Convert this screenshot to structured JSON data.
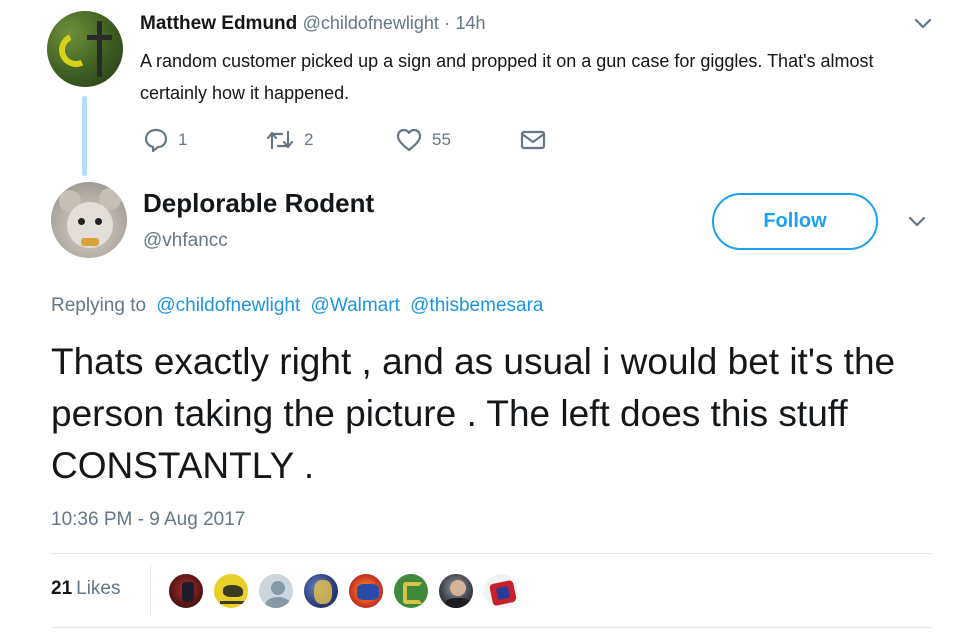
{
  "parent_tweet": {
    "name": "Matthew Edmund",
    "handle": "@childofnewlight",
    "separator": "·",
    "time": "14h",
    "text": "A random customer picked up a sign and propped it on a gun case for giggles. That's almost certainly how it happened.",
    "actions": {
      "reply_icon": "reply-icon",
      "reply_count": "1",
      "retweet_icon": "retweet-icon",
      "retweet_count": "2",
      "like_icon": "heart-icon",
      "like_count": "55",
      "dm_icon": "envelope-icon"
    }
  },
  "main_tweet": {
    "name": "Deplorable Rodent",
    "handle": "@vhfancc",
    "follow_label": "Follow",
    "replying_to_label": "Replying to",
    "mentions": [
      "@childofnewlight",
      "@Walmart",
      "@thisbemesara"
    ],
    "text": "Thats exactly right , and as usual i would bet it's the person taking the picture .  The left does this stuff CONSTANTLY .",
    "timestamp": "10:36 PM - 9 Aug 2017",
    "likes_count": "21",
    "likes_label": "Likes"
  },
  "colors": {
    "accent": "#1da1f2",
    "mention": "#1b95e0",
    "muted": "#657786",
    "thread_line": "#b3dcf5",
    "divider": "#e1e8ed"
  }
}
